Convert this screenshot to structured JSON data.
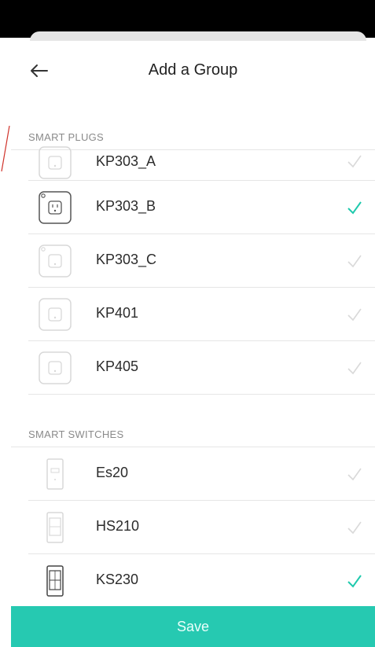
{
  "header": {
    "title": "Add a Group"
  },
  "sections": [
    {
      "title": "SMART PLUGS",
      "items": [
        {
          "label": "KP303_A",
          "checked": false,
          "icon": "smart-plug-icon"
        },
        {
          "label": "KP303_B",
          "checked": true,
          "icon": "smart-plug-icon"
        },
        {
          "label": "KP303_C",
          "checked": false,
          "icon": "smart-plug-icon"
        },
        {
          "label": "KP401",
          "checked": false,
          "icon": "smart-plug-icon"
        },
        {
          "label": "KP405",
          "checked": false,
          "icon": "smart-plug-icon"
        }
      ]
    },
    {
      "title": "SMART SWITCHES",
      "items": [
        {
          "label": "Es20",
          "checked": false,
          "icon": "light-switch-icon"
        },
        {
          "label": "HS210",
          "checked": false,
          "icon": "light-switch-icon"
        },
        {
          "label": "KS230",
          "checked": true,
          "icon": "light-switch-icon"
        }
      ]
    }
  ],
  "footer": {
    "save_label": "Save"
  },
  "colors": {
    "accent": "#26c9b1",
    "check_on": "#1fc9ad",
    "check_off": "#d9d9d9"
  }
}
